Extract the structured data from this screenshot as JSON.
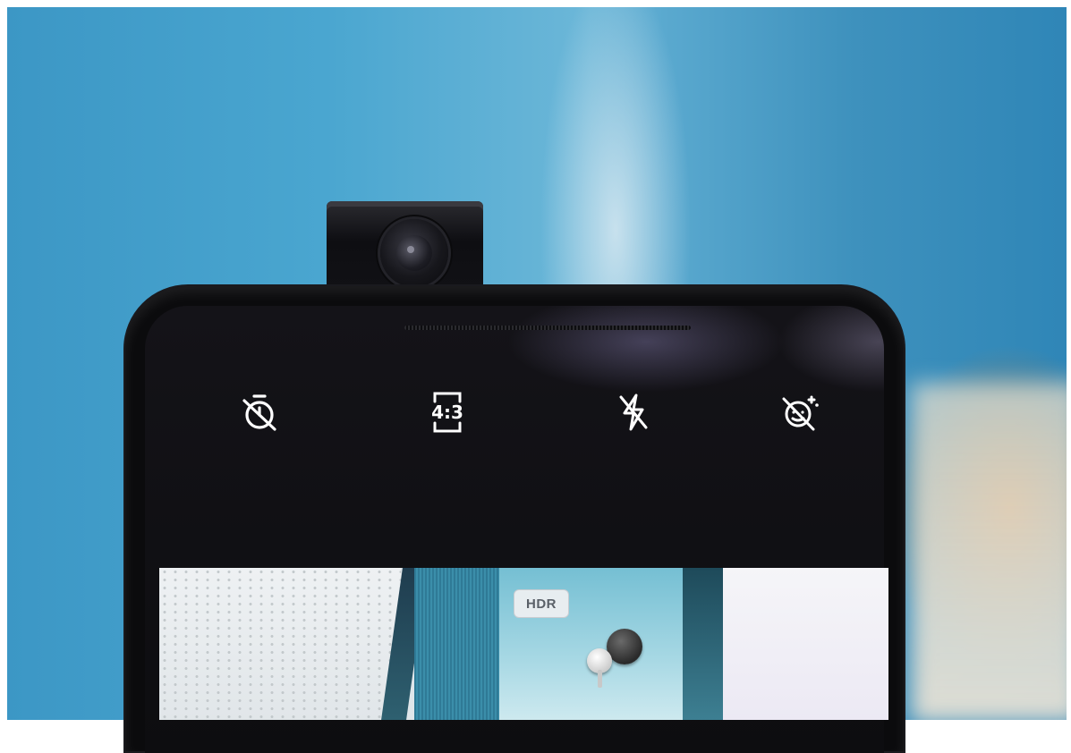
{
  "camera_ui": {
    "toolbar": {
      "timer_icon": "timer-off-icon",
      "aspect_ratio_label": "4:3",
      "flash_icon": "flash-off-icon",
      "beauty_icon": "beauty-off-icon"
    },
    "viewfinder": {
      "hdr_badge": "HDR"
    }
  },
  "colors": {
    "background_blue": "#3c97c5",
    "phone_body": "#0b0b0d",
    "icon_white": "#ffffff"
  }
}
